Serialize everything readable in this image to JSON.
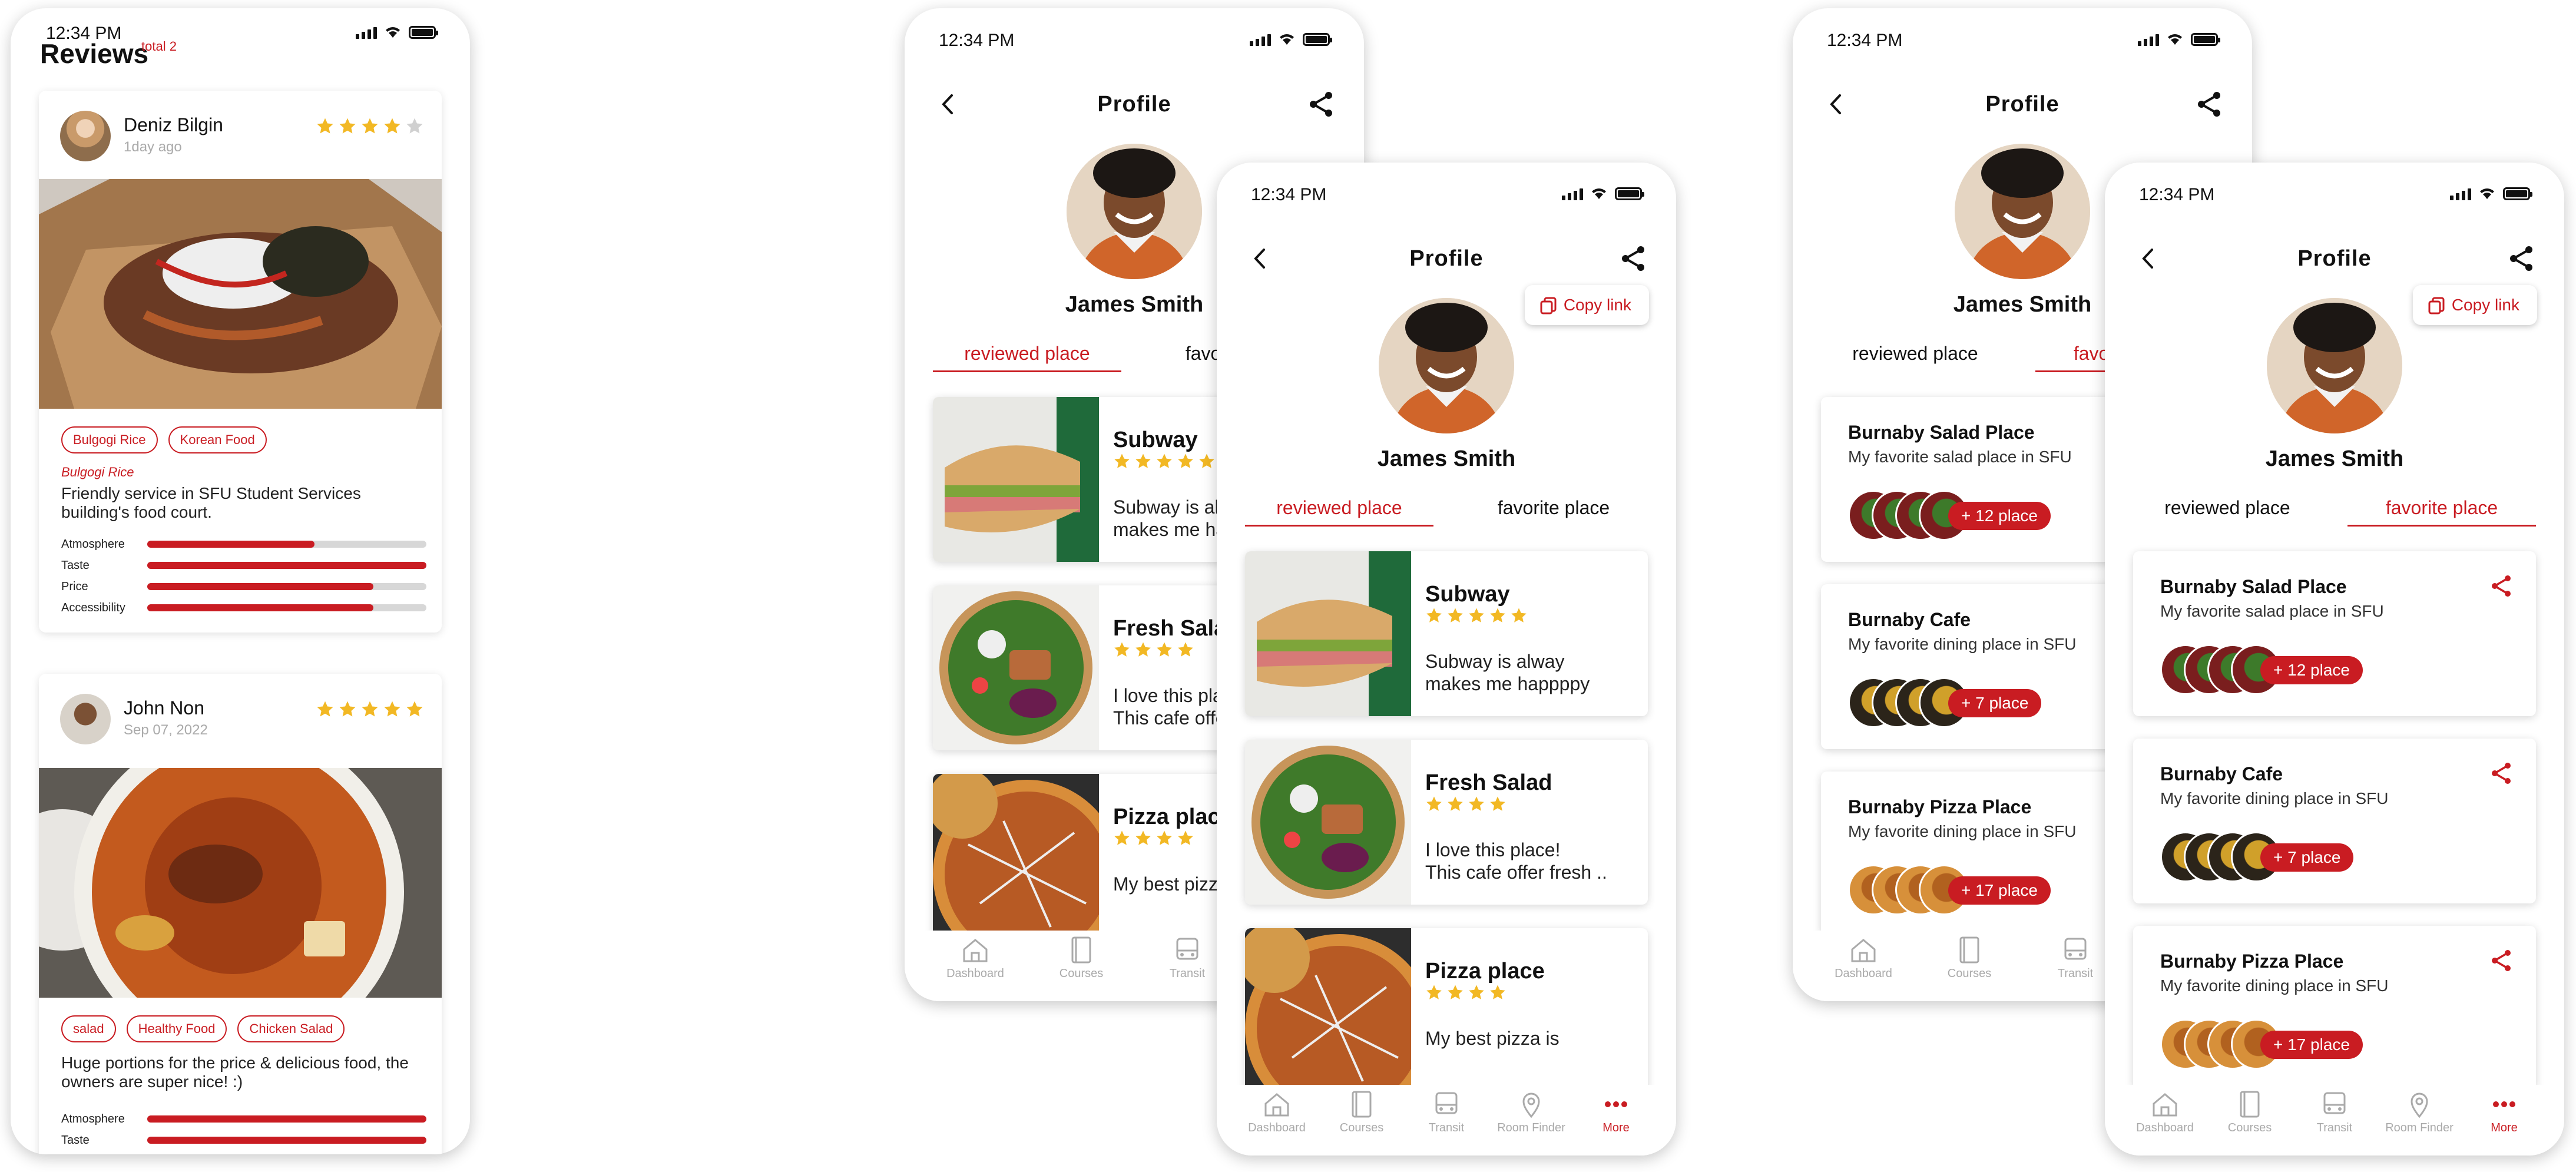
{
  "status": {
    "time": "12:34 PM"
  },
  "reviews_screen": {
    "title": "Reviews",
    "total": "total 2",
    "reviews": [
      {
        "name": "Deniz Bilgin",
        "time": "1day ago",
        "rating": 4,
        "tags": [
          "Bulgogi Rice",
          "Korean Food"
        ],
        "dish": "Bulgogi Rice",
        "text": "Friendly service in SFU Student Services building's food court.",
        "metrics": [
          {
            "label": "Atmosphere",
            "value": 0.6
          },
          {
            "label": "Taste",
            "value": 1.0
          },
          {
            "label": "Price",
            "value": 0.81
          },
          {
            "label": "Accessibility",
            "value": 0.81
          }
        ]
      },
      {
        "name": "John Non",
        "time": "Sep 07, 2022",
        "rating": 5,
        "tags": [
          "salad",
          "Healthy Food",
          "Chicken Salad"
        ],
        "text": "Huge portions for the price & delicious food, the owners are super nice! :)",
        "metrics": [
          {
            "label": "Atmosphere",
            "value": 1.0
          },
          {
            "label": "Taste",
            "value": 1.0
          }
        ]
      }
    ]
  },
  "profile": {
    "title": "Profile",
    "name": "James Smith",
    "copy_link": "Copy link",
    "tabs": [
      "reviewed place",
      "favorite place"
    ],
    "reviewed_places": [
      {
        "name": "Subway",
        "rating": 5,
        "line1": "Subway is alway",
        "line2": "makes me happppy"
      },
      {
        "name": "Fresh Salad",
        "rating": 4,
        "line1": "I love this place!",
        "line2": "This cafe offer fresh .."
      },
      {
        "name": "Pizza place",
        "rating": 4,
        "line1": "My best pizza is",
        "line2": ""
      }
    ],
    "favorite_places": [
      {
        "name": "Burnaby Salad Place",
        "sub": "My favorite salad place in SFU",
        "count": "+ 12 place",
        "kind": "salad"
      },
      {
        "name": "Burnaby Cafe",
        "sub": "My favorite dining place in SFU",
        "count": "+ 7 place",
        "kind": "cafe"
      },
      {
        "name": "Burnaby Pizza Place",
        "sub": "My favorite dining place in SFU",
        "count": "+ 17 place",
        "kind": "pizza"
      }
    ]
  },
  "nav": [
    "Dashboard",
    "Courses",
    "Transit",
    "Room Finder",
    "More"
  ],
  "colors": {
    "accent": "#c91c22",
    "star": "#f2b824"
  }
}
